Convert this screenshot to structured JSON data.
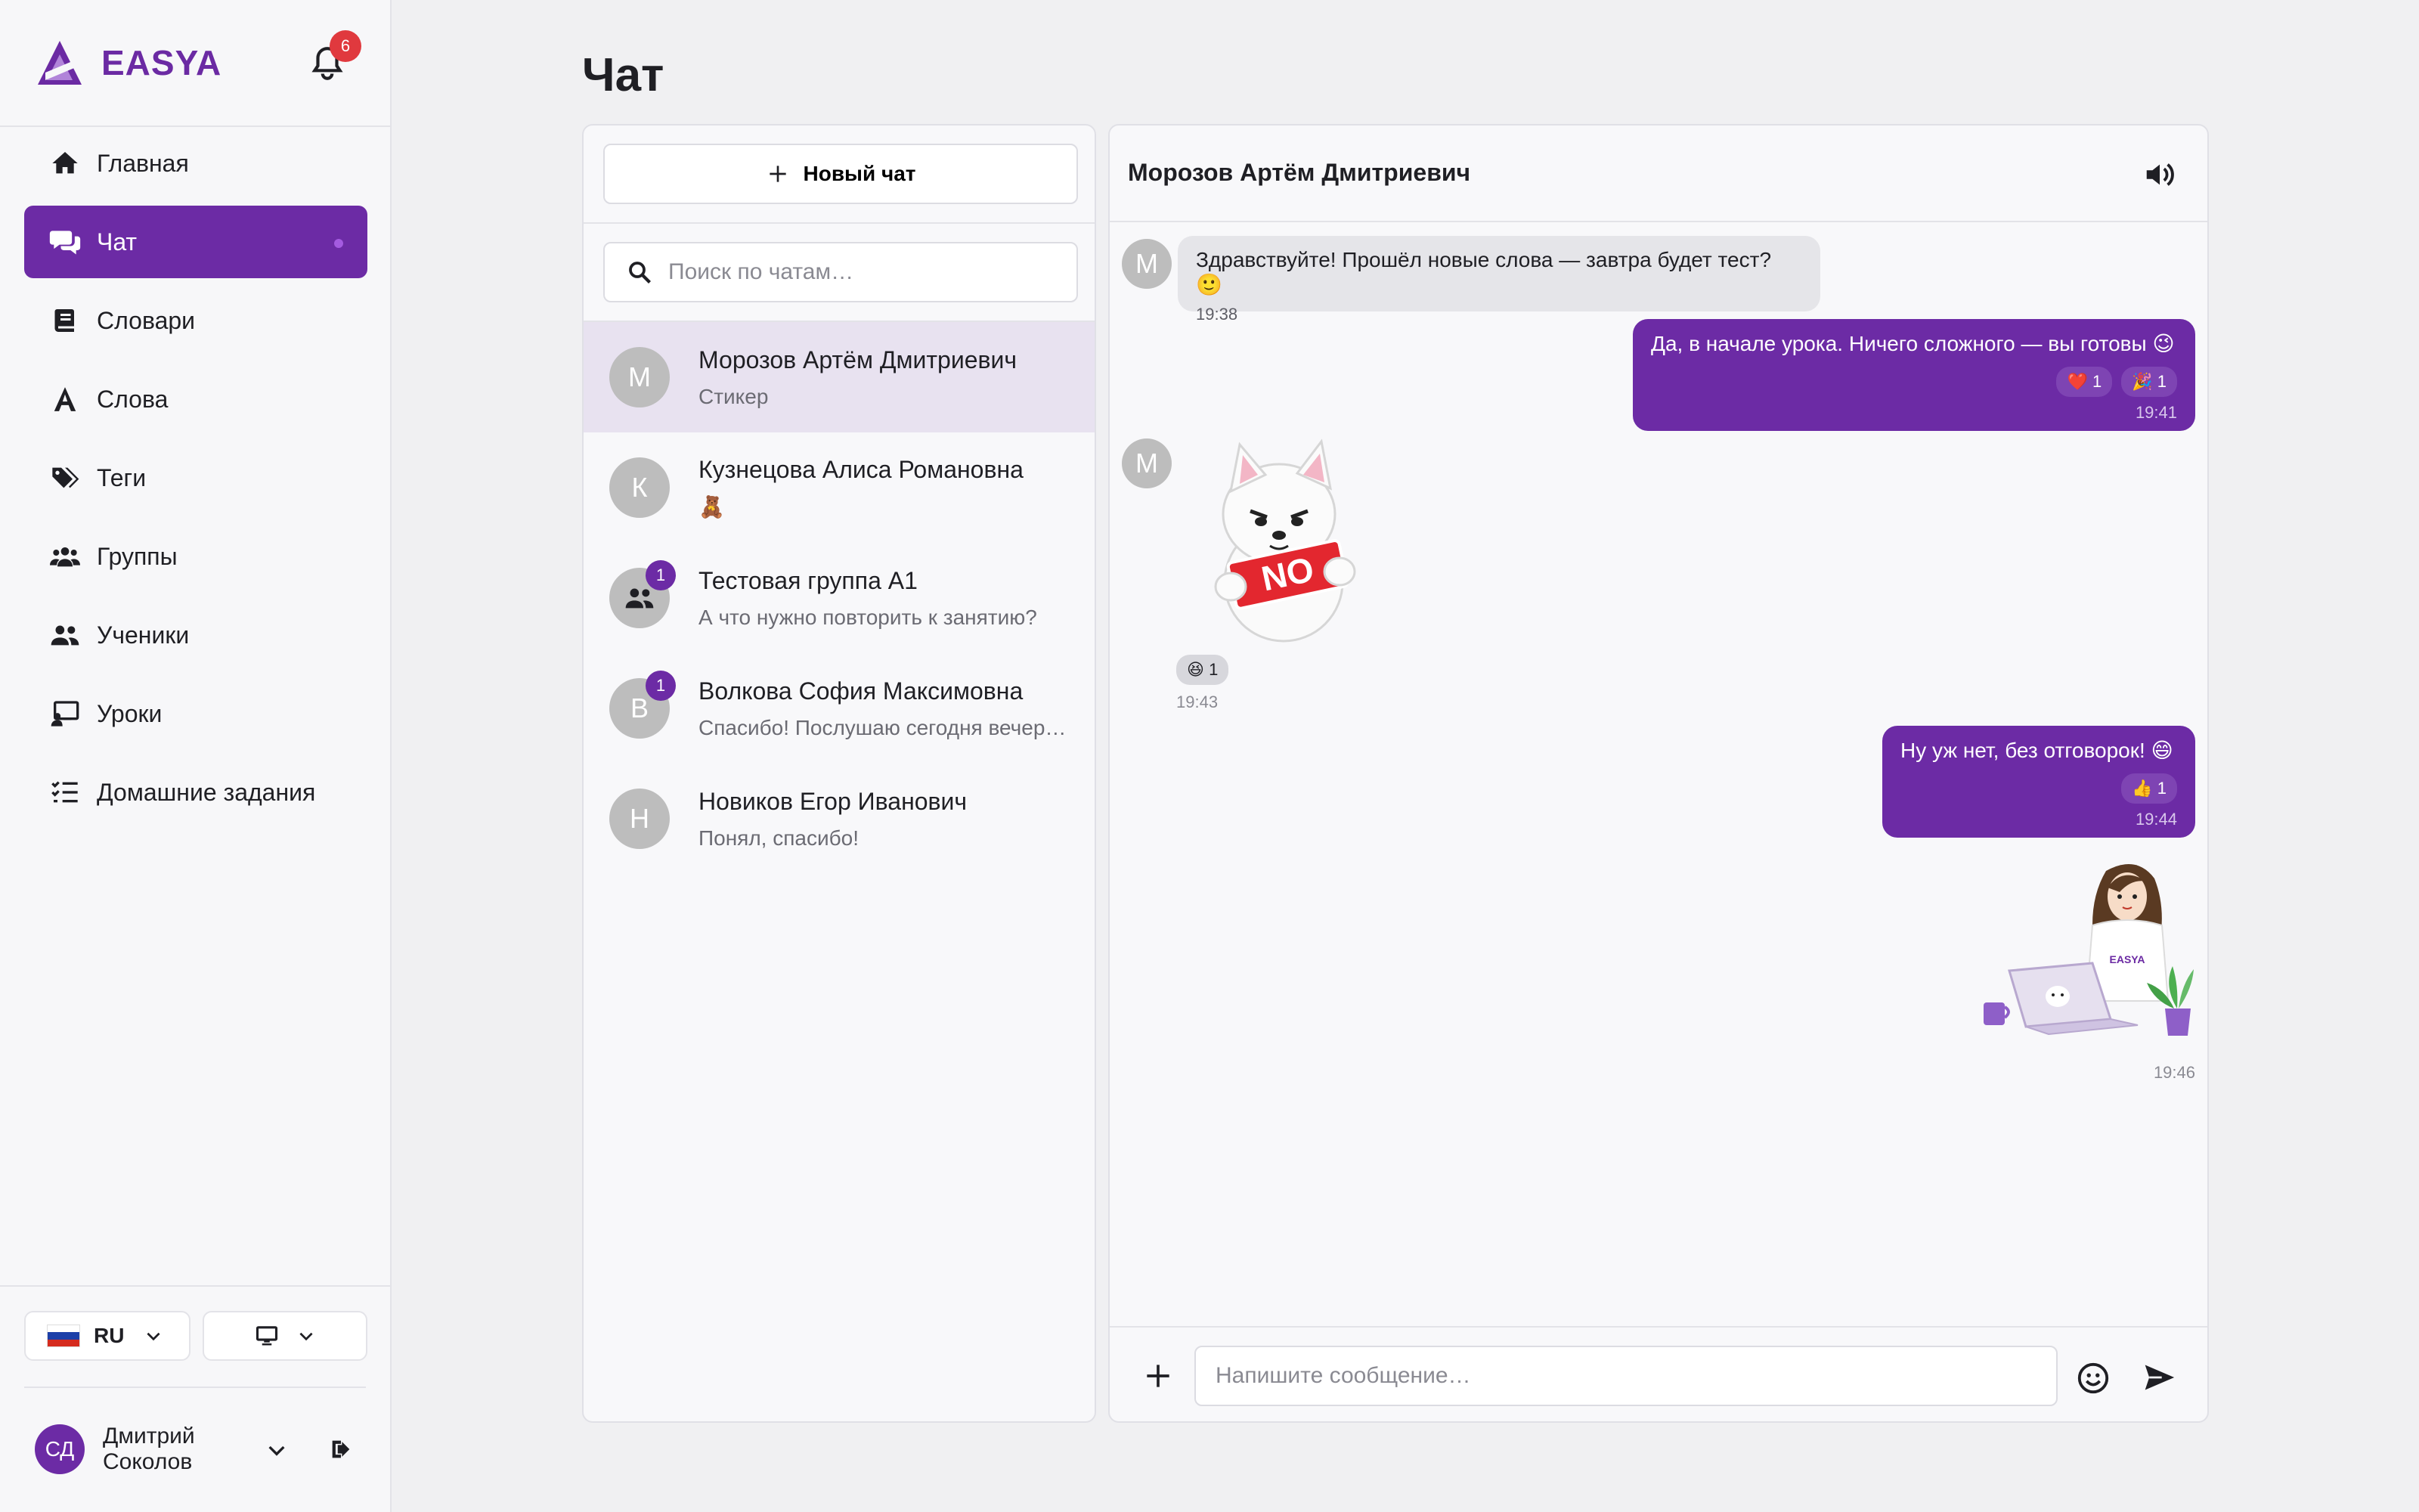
{
  "brand": {
    "name": "EASYA"
  },
  "notifications": {
    "count": "6"
  },
  "nav": {
    "items": [
      {
        "label": "Главная",
        "icon": "home-icon"
      },
      {
        "label": "Чат",
        "icon": "chat-icon",
        "active": true
      },
      {
        "label": "Словари",
        "icon": "book-icon"
      },
      {
        "label": "Слова",
        "icon": "letter-a-icon"
      },
      {
        "label": "Теги",
        "icon": "tags-icon"
      },
      {
        "label": "Группы",
        "icon": "groups-icon"
      },
      {
        "label": "Ученики",
        "icon": "students-icon"
      },
      {
        "label": "Уроки",
        "icon": "lessons-icon"
      },
      {
        "label": "Домашние задания",
        "icon": "homework-icon"
      }
    ]
  },
  "language": {
    "code": "RU"
  },
  "user": {
    "initials": "СД",
    "name": "Дмитрий Соколов"
  },
  "page": {
    "title": "Чат"
  },
  "chat_list": {
    "new_chat_label": "Новый чат",
    "search_placeholder": "Поиск по чатам…",
    "conversations": [
      {
        "avatar": "М",
        "name": "Морозов Артём Дмитриевич",
        "preview": "Стикер",
        "selected": true
      },
      {
        "avatar": "К",
        "name": "Кузнецова Алиса Романовна",
        "preview": "🧸"
      },
      {
        "avatar": "group",
        "name": "Тестовая группа А1",
        "preview": "А что нужно повторить к занятию?",
        "unread": "1"
      },
      {
        "avatar": "В",
        "name": "Волкова София Максимовна",
        "preview": "Спасибо! Послушаю сегодня вечер…",
        "unread": "1"
      },
      {
        "avatar": "Н",
        "name": "Новиков Егор Иванович",
        "preview": "Понял, спасибо!"
      }
    ]
  },
  "chat": {
    "title": "Морозов Артём Дмитриевич",
    "messages": [
      {
        "direction": "in",
        "avatar": "М",
        "text": "Здравствуйте! Прошёл новые слова — завтра будет тест? 🙂",
        "time": "19:38"
      },
      {
        "direction": "out",
        "text": "Да, в начале урока. Ничего сложного — вы готовы 😉",
        "reactions": [
          {
            "emoji": "❤️",
            "count": "1"
          },
          {
            "emoji": "🎉",
            "count": "1"
          }
        ],
        "time": "19:41"
      },
      {
        "direction": "in",
        "avatar": "М",
        "sticker": "white-dog-no-sticker",
        "sticker_text": "NO",
        "reactions": [
          {
            "emoji": "😆",
            "count": "1"
          }
        ],
        "time": "19:43"
      },
      {
        "direction": "out",
        "text": "Ну уж нет, без отговорок! 😄",
        "reactions": [
          {
            "emoji": "👍",
            "count": "1"
          }
        ],
        "time": "19:44"
      },
      {
        "direction": "out",
        "sticker": "teacher-laptop-sticker",
        "sticker_text": "EASYA",
        "time": "19:46"
      }
    ],
    "composer_placeholder": "Напишите сообщение…"
  },
  "colors": {
    "accent": "#6c2ba5",
    "badge": "#e0393e",
    "selected_row": "#e8e2f0"
  }
}
